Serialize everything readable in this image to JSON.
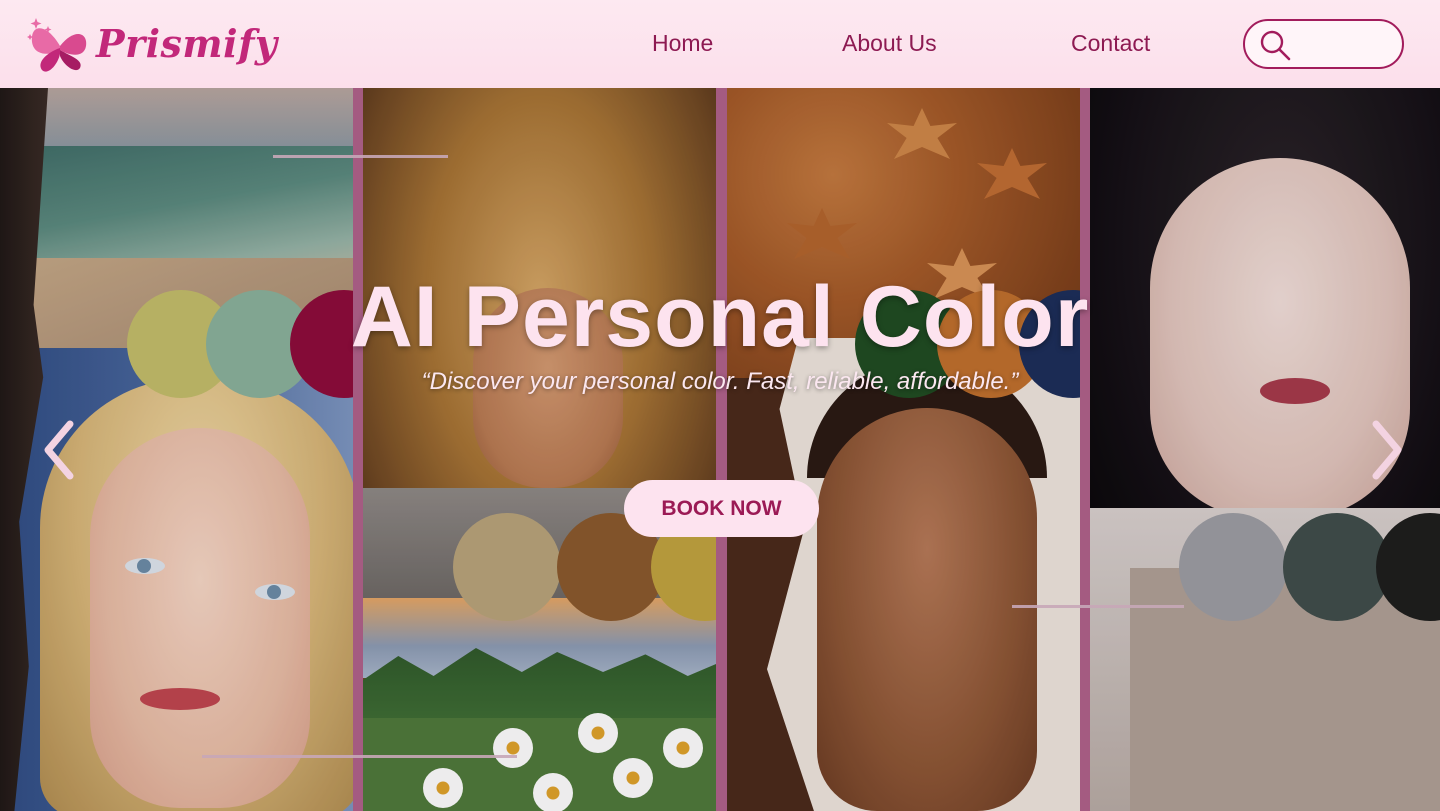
{
  "brand": {
    "name": "Prismify",
    "color": "#c2287a"
  },
  "nav": {
    "items": [
      {
        "label": "Home"
      },
      {
        "label": "About Us"
      },
      {
        "label": "Contact"
      }
    ],
    "link_color": "#8d1a52"
  },
  "search": {
    "placeholder": "",
    "icon": "search-icon"
  },
  "hero": {
    "title": "AI Personal Color",
    "subtitle": "“Discover your personal color. Fast, reliable, affordable.”",
    "cta_label": "BOOK NOW",
    "prev_icon": "chevron-left-icon",
    "next_icon": "chevron-right-icon"
  },
  "palettes": {
    "spring_summer": [
      "#c4be6a",
      "#8ab29c",
      "#8e0b3a"
    ],
    "autumn": [
      "#b9a47a",
      "#8a5a2c",
      "#c2a43e"
    ],
    "mid": [
      "#1f4d21",
      "#c0702c",
      "#1c2e5a"
    ],
    "winter": [
      "#9d9ea3",
      "#3f4e4a",
      "#1d1e1c"
    ]
  },
  "colors": {
    "header_bg": "#fde9f1",
    "divider": "#b0628a",
    "title": "#fde3ef",
    "button_bg": "#fde3ef",
    "button_text": "#9b1a55"
  }
}
